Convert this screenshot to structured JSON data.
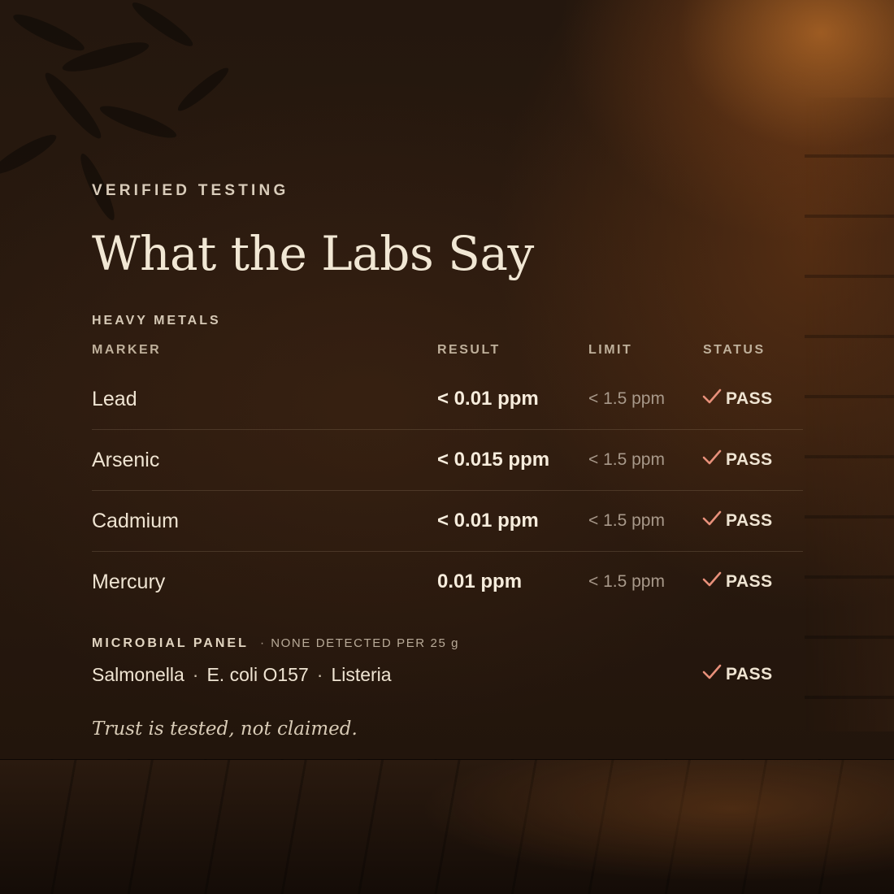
{
  "eyebrow": "VERIFIED TESTING",
  "title": "What the Labs Say",
  "heavy_metals": {
    "section_label": "HEAVY METALS",
    "columns": {
      "marker": "MARKER",
      "result": "RESULT",
      "limit": "LIMIT",
      "status": "STATUS"
    },
    "rows": [
      {
        "marker": "Lead",
        "result": "< 0.01 ppm",
        "limit": "< 1.5 ppm",
        "status": "PASS"
      },
      {
        "marker": "Arsenic",
        "result": "< 0.015 ppm",
        "limit": "< 1.5 ppm",
        "status": "PASS"
      },
      {
        "marker": "Cadmium",
        "result": "< 0.01 ppm",
        "limit": "< 1.5 ppm",
        "status": "PASS"
      },
      {
        "marker": "Mercury",
        "result": "0.01 ppm",
        "limit": "< 1.5 ppm",
        "status": "PASS"
      }
    ]
  },
  "microbial": {
    "section_label": "MICROBIAL PANEL",
    "separator": "·",
    "note": "NONE DETECTED PER 25 g",
    "pathogens": [
      "Salmonella",
      "E. coli O157",
      "Listeria"
    ],
    "status": "PASS"
  },
  "tagline": "Trust is tested, not claimed.",
  "icons": {
    "status": "check-icon"
  },
  "colors": {
    "check": "#e8907a",
    "text": "#efe4d2",
    "title": "#f1e7d4",
    "muted": "#a8998a"
  }
}
